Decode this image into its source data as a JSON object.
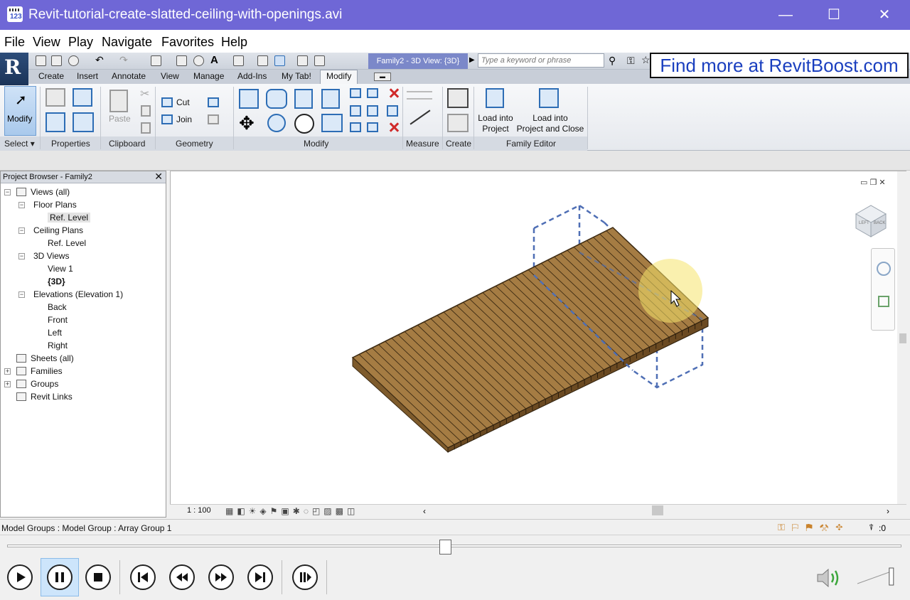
{
  "window": {
    "title": "Revit-tutorial-create-slatted-ceiling-with-openings.avi",
    "app_icon_text": "123"
  },
  "player_menu": [
    "File",
    "View",
    "Play",
    "Navigate",
    "Favorites",
    "Help"
  ],
  "revit": {
    "view_title": "Family2 - 3D View: {3D}",
    "search_placeholder": "Type a keyword or phrase",
    "promo": "Find more at RevitBoost.com",
    "tabs": [
      "Create",
      "Insert",
      "Annotate",
      "View",
      "Manage",
      "Add-Ins",
      "My Tab!",
      "Modify"
    ],
    "active_tab": "Modify",
    "ribbon": {
      "modify_label": "Modify",
      "paste_label": "Paste",
      "cut_label": "Cut",
      "join_label": "Join",
      "load_into_project": [
        "Load into",
        "Project"
      ],
      "load_into_project_close": [
        "Load into",
        "Project and Close"
      ],
      "panels": [
        "Select",
        "Properties",
        "Clipboard",
        "Geometry",
        "Modify",
        "Measure",
        "Create",
        "Family Editor"
      ]
    },
    "project_browser": {
      "title": "Project Browser - Family2",
      "close_glyph": "✕",
      "tree": [
        {
          "label": "Views (all)",
          "level": 0,
          "toggle": "−",
          "icon": true
        },
        {
          "label": "Floor Plans",
          "level": 1,
          "toggle": "−"
        },
        {
          "label": "Ref. Level",
          "level": 2,
          "selected": true
        },
        {
          "label": "Ceiling Plans",
          "level": 1,
          "toggle": "−"
        },
        {
          "label": "Ref. Level",
          "level": 2
        },
        {
          "label": "3D Views",
          "level": 1,
          "toggle": "−"
        },
        {
          "label": "View 1",
          "level": 2
        },
        {
          "label": "{3D}",
          "level": 2,
          "bold": true
        },
        {
          "label": "Elevations (Elevation 1)",
          "level": 1,
          "toggle": "−"
        },
        {
          "label": "Back",
          "level": 2
        },
        {
          "label": "Front",
          "level": 2
        },
        {
          "label": "Left",
          "level": 2
        },
        {
          "label": "Right",
          "level": 2
        },
        {
          "label": "Sheets (all)",
          "level": 0,
          "icon": true
        },
        {
          "label": "Families",
          "level": 0,
          "toggle": "+",
          "icon": true
        },
        {
          "label": "Groups",
          "level": 0,
          "toggle": "+",
          "icon": true
        },
        {
          "label": "Revit Links",
          "level": 0,
          "icon": true
        }
      ]
    },
    "viewcube_labels": [
      "LEFT",
      "BACK"
    ],
    "view_scale": "1 : 100",
    "status": "Model Groups : Model Group : Array Group 1",
    "filter_count": ":0"
  },
  "player": {
    "seek_position": 0.49,
    "volume_level": 0.9
  },
  "colors": {
    "titlebar": "#6f67d6",
    "wood": "#a57c43",
    "wood_dark": "#6b4a22",
    "highlight": "#f6e36b",
    "group_dashes": "#4f6fb5",
    "promo_text": "#1a3fbf"
  }
}
